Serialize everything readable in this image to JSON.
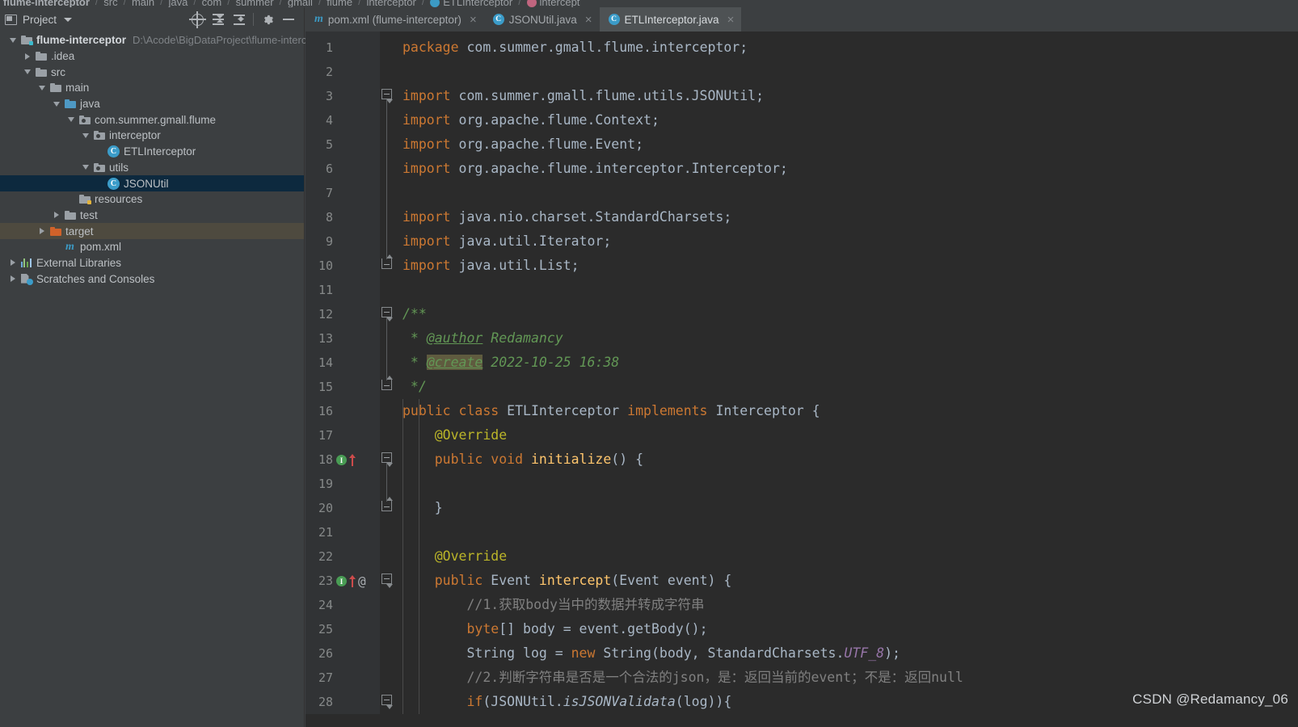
{
  "breadcrumb": {
    "items": [
      {
        "label": "flume-interceptor",
        "bold": true,
        "icon": null
      },
      {
        "label": "src",
        "bold": false,
        "icon": null
      },
      {
        "label": "main",
        "bold": false,
        "icon": null
      },
      {
        "label": "java",
        "bold": false,
        "icon": null
      },
      {
        "label": "com",
        "bold": false,
        "icon": null
      },
      {
        "label": "summer",
        "bold": false,
        "icon": null
      },
      {
        "label": "gmall",
        "bold": false,
        "icon": null
      },
      {
        "label": "flume",
        "bold": false,
        "icon": null
      },
      {
        "label": "interceptor",
        "bold": false,
        "icon": null
      },
      {
        "label": "ETLInterceptor",
        "bold": false,
        "icon": "class-icon"
      },
      {
        "label": "intercept",
        "bold": false,
        "icon": "method-icon"
      }
    ],
    "separator": "/"
  },
  "project_panel": {
    "title": "Project",
    "dropdown_icon": "chevron-down-icon",
    "window_icon": "project-window-icon",
    "actions": [
      {
        "name": "select-opened-file-button",
        "icon": "locate-target-icon"
      },
      {
        "name": "expand-all-button",
        "icon": "expand-all-icon"
      },
      {
        "name": "collapse-all-button",
        "icon": "collapse-all-icon"
      },
      {
        "name": "settings-button",
        "icon": "gear-icon"
      },
      {
        "name": "hide-panel-button",
        "icon": "minimize-icon"
      }
    ],
    "tree": [
      {
        "label": "flume-interceptor",
        "path": "D:\\Acode\\BigDataProject\\flume-interce",
        "indent": 0,
        "twisty": "down",
        "icon": "module-folder",
        "bold": true,
        "state": "normal"
      },
      {
        "label": ".idea",
        "path": "",
        "indent": 1,
        "twisty": "right",
        "icon": "folder",
        "bold": false,
        "state": "normal"
      },
      {
        "label": "src",
        "path": "",
        "indent": 1,
        "twisty": "down",
        "icon": "folder",
        "bold": false,
        "state": "normal"
      },
      {
        "label": "main",
        "path": "",
        "indent": 2,
        "twisty": "down",
        "icon": "folder",
        "bold": false,
        "state": "normal"
      },
      {
        "label": "java",
        "path": "",
        "indent": 3,
        "twisty": "down",
        "icon": "source-folder",
        "bold": false,
        "state": "normal"
      },
      {
        "label": "com.summer.gmall.flume",
        "path": "",
        "indent": 4,
        "twisty": "down",
        "icon": "package",
        "bold": false,
        "state": "normal"
      },
      {
        "label": "interceptor",
        "path": "",
        "indent": 5,
        "twisty": "down",
        "icon": "package",
        "bold": false,
        "state": "normal"
      },
      {
        "label": "ETLInterceptor",
        "path": "",
        "indent": 6,
        "twisty": "none",
        "icon": "java-class",
        "bold": false,
        "state": "normal"
      },
      {
        "label": "utils",
        "path": "",
        "indent": 5,
        "twisty": "down",
        "icon": "package",
        "bold": false,
        "state": "normal"
      },
      {
        "label": "JSONUtil",
        "path": "",
        "indent": 6,
        "twisty": "none",
        "icon": "java-class",
        "bold": false,
        "state": "selected"
      },
      {
        "label": "resources",
        "path": "",
        "indent": 4,
        "twisty": "none",
        "icon": "resource-folder",
        "bold": false,
        "state": "normal"
      },
      {
        "label": "test",
        "path": "",
        "indent": 3,
        "twisty": "right",
        "icon": "folder",
        "bold": false,
        "state": "normal"
      },
      {
        "label": "target",
        "path": "",
        "indent": 2,
        "twisty": "right",
        "icon": "excluded-folder",
        "bold": false,
        "state": "hovered"
      },
      {
        "label": "pom.xml",
        "path": "",
        "indent": 3,
        "twisty": "none",
        "icon": "maven-file",
        "bold": false,
        "state": "normal"
      },
      {
        "label": "External Libraries",
        "path": "",
        "indent": 0,
        "twisty": "right",
        "icon": "libraries",
        "bold": false,
        "state": "normal"
      },
      {
        "label": "Scratches and Consoles",
        "path": "",
        "indent": 0,
        "twisty": "right",
        "icon": "scratches",
        "bold": false,
        "state": "normal"
      }
    ]
  },
  "editor": {
    "tabs": [
      {
        "label": "pom.xml (flume-interceptor)",
        "icon": "maven-file-icon",
        "active": false,
        "close": "×"
      },
      {
        "label": "JSONUtil.java",
        "icon": "java-class-icon",
        "active": false,
        "close": "×"
      },
      {
        "label": "ETLInterceptor.java",
        "icon": "java-class-icon",
        "active": true,
        "close": "×"
      }
    ],
    "language": "java",
    "lines": [
      {
        "num": 1,
        "tokens": [
          {
            "t": "package ",
            "c": "kw"
          },
          {
            "t": "com.summer.gmall.flume.interceptor;",
            "c": "plain"
          }
        ],
        "indent": 0,
        "gutter": null,
        "fold": null
      },
      {
        "num": 2,
        "tokens": [],
        "indent": 0,
        "gutter": null,
        "fold": null
      },
      {
        "num": 3,
        "tokens": [
          {
            "t": "import ",
            "c": "kw"
          },
          {
            "t": "com.summer.gmall.flume.utils.JSONUtil;",
            "c": "plain"
          }
        ],
        "indent": 0,
        "gutter": null,
        "fold": "start"
      },
      {
        "num": 4,
        "tokens": [
          {
            "t": "import ",
            "c": "kw"
          },
          {
            "t": "org.apache.flume.Context;",
            "c": "plain"
          }
        ],
        "indent": 0,
        "gutter": null,
        "fold": null
      },
      {
        "num": 5,
        "tokens": [
          {
            "t": "import ",
            "c": "kw"
          },
          {
            "t": "org.apache.flume.Event;",
            "c": "plain"
          }
        ],
        "indent": 0,
        "gutter": null,
        "fold": null
      },
      {
        "num": 6,
        "tokens": [
          {
            "t": "import ",
            "c": "kw"
          },
          {
            "t": "org.apache.flume.interceptor.Interceptor;",
            "c": "plain"
          }
        ],
        "indent": 0,
        "gutter": null,
        "fold": null
      },
      {
        "num": 7,
        "tokens": [],
        "indent": 0,
        "gutter": null,
        "fold": null
      },
      {
        "num": 8,
        "tokens": [
          {
            "t": "import ",
            "c": "kw"
          },
          {
            "t": "java.nio.charset.StandardCharsets;",
            "c": "plain"
          }
        ],
        "indent": 0,
        "gutter": null,
        "fold": null
      },
      {
        "num": 9,
        "tokens": [
          {
            "t": "import ",
            "c": "kw"
          },
          {
            "t": "java.util.Iterator;",
            "c": "plain"
          }
        ],
        "indent": 0,
        "gutter": null,
        "fold": null
      },
      {
        "num": 10,
        "tokens": [
          {
            "t": "import ",
            "c": "kw"
          },
          {
            "t": "java.util.List;",
            "c": "plain"
          }
        ],
        "indent": 0,
        "gutter": null,
        "fold": "end"
      },
      {
        "num": 11,
        "tokens": [],
        "indent": 0,
        "gutter": null,
        "fold": null
      },
      {
        "num": 12,
        "tokens": [
          {
            "t": "/**",
            "c": "doc"
          }
        ],
        "indent": 0,
        "gutter": null,
        "fold": "start"
      },
      {
        "num": 13,
        "tokens": [
          {
            "t": " * ",
            "c": "doc"
          },
          {
            "t": "@author",
            "c": "doctag"
          },
          {
            "t": " Redamancy",
            "c": "doc"
          }
        ],
        "indent": 0,
        "gutter": null,
        "fold": null
      },
      {
        "num": 14,
        "tokens": [
          {
            "t": " * ",
            "c": "doc"
          },
          {
            "t": "@create",
            "c": "doctag-hl"
          },
          {
            "t": " 2022-10-25 16:38",
            "c": "doc"
          }
        ],
        "indent": 0,
        "gutter": null,
        "fold": null
      },
      {
        "num": 15,
        "tokens": [
          {
            "t": " */",
            "c": "doc"
          }
        ],
        "indent": 0,
        "gutter": null,
        "fold": "end"
      },
      {
        "num": 16,
        "tokens": [
          {
            "t": "public class ",
            "c": "kw"
          },
          {
            "t": "ETLInterceptor ",
            "c": "cls2"
          },
          {
            "t": "implements ",
            "c": "kw"
          },
          {
            "t": "Interceptor {",
            "c": "plain"
          }
        ],
        "indent": 0,
        "gutter": null,
        "fold": null
      },
      {
        "num": 17,
        "tokens": [
          {
            "t": "    @Override",
            "c": "ann"
          }
        ],
        "indent": 0,
        "gutter": null,
        "fold": null
      },
      {
        "num": 18,
        "tokens": [
          {
            "t": "    public void ",
            "c": "kw"
          },
          {
            "t": "initialize",
            "c": "mth"
          },
          {
            "t": "() {",
            "c": "plain"
          }
        ],
        "indent": 0,
        "gutter": "implements-override",
        "fold": "start"
      },
      {
        "num": 19,
        "tokens": [],
        "indent": 0,
        "gutter": null,
        "fold": null
      },
      {
        "num": 20,
        "tokens": [
          {
            "t": "    }",
            "c": "plain"
          }
        ],
        "indent": 0,
        "gutter": null,
        "fold": "end"
      },
      {
        "num": 21,
        "tokens": [],
        "indent": 0,
        "gutter": null,
        "fold": null
      },
      {
        "num": 22,
        "tokens": [
          {
            "t": "    @Override",
            "c": "ann"
          }
        ],
        "indent": 0,
        "gutter": null,
        "fold": null
      },
      {
        "num": 23,
        "tokens": [
          {
            "t": "    public ",
            "c": "kw"
          },
          {
            "t": "Event ",
            "c": "plain"
          },
          {
            "t": "intercept",
            "c": "mth"
          },
          {
            "t": "(Event event) {",
            "c": "plain"
          }
        ],
        "indent": 0,
        "gutter": "implements-override-at",
        "fold": "start"
      },
      {
        "num": 24,
        "tokens": [
          {
            "t": "        //1.获取body当中的数据并转成字符串",
            "c": "cmt"
          }
        ],
        "indent": 0,
        "gutter": null,
        "fold": null
      },
      {
        "num": 25,
        "tokens": [
          {
            "t": "        byte",
            "c": "kw"
          },
          {
            "t": "[] body = event.getBody();",
            "c": "plain"
          }
        ],
        "indent": 0,
        "gutter": null,
        "fold": null
      },
      {
        "num": 26,
        "tokens": [
          {
            "t": "        String log = ",
            "c": "plain"
          },
          {
            "t": "new ",
            "c": "kw"
          },
          {
            "t": "String(body, StandardCharsets.",
            "c": "plain"
          },
          {
            "t": "UTF_8",
            "c": "stat"
          },
          {
            "t": ");",
            "c": "plain"
          }
        ],
        "indent": 0,
        "gutter": null,
        "fold": null
      },
      {
        "num": 27,
        "tokens": [
          {
            "t": "        //2.判断字符串是否是一个合法的json，是：返回当前的event；不是：返回null",
            "c": "cmt"
          }
        ],
        "indent": 0,
        "gutter": null,
        "fold": null
      },
      {
        "num": 28,
        "tokens": [
          {
            "t": "        if",
            "c": "kw"
          },
          {
            "t": "(JSONUtil.",
            "c": "plain"
          },
          {
            "t": "isJSONValidata",
            "c": "statm"
          },
          {
            "t": "(log)){",
            "c": "plain"
          }
        ],
        "indent": 0,
        "gutter": null,
        "fold": "start"
      }
    ]
  },
  "watermark": "CSDN @Redamancy_06",
  "colors": {
    "panel_bg": "#3c3f41",
    "editor_bg": "#2b2b2b",
    "gutter_bg": "#313335",
    "tab_active_bg": "#4e5254",
    "tree_selected_bg": "#0d293e",
    "tree_hover_bg": "#4e4a3f",
    "keyword": "#cc7832",
    "method": "#ffc66d",
    "annotation": "#bbb529",
    "comment": "#808080",
    "javadoc": "#629755",
    "static_field": "#9876aa",
    "default_text": "#a9b7c6"
  }
}
